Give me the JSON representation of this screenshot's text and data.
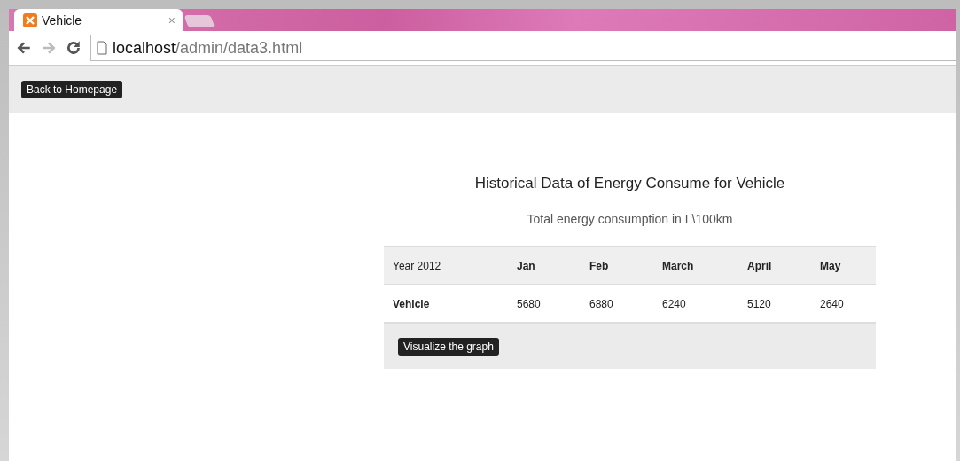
{
  "browser": {
    "tab": {
      "title": "Vehicle",
      "close": "×"
    },
    "address": {
      "host": "localhost",
      "path": "/admin/data3.html"
    }
  },
  "page": {
    "back_button": "Back to Homepage",
    "title": "Historical Data of Energy Consume for Vehicle",
    "subtitle": "Total energy consumption in L\\100km",
    "table": {
      "columns": [
        "Year 2012",
        "Jan",
        "Feb",
        "March",
        "April",
        "May"
      ],
      "rows": [
        [
          "Vehicle",
          "5680",
          "6880",
          "6240",
          "5120",
          "2640"
        ]
      ]
    },
    "graph_button": "Visualize the graph"
  }
}
